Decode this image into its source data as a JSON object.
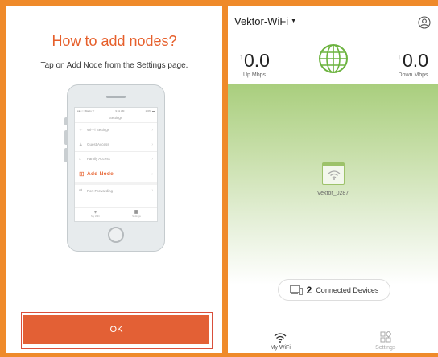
{
  "help": {
    "title": "How to add nodes?",
    "instruction": "Tap on Add Node from the Settings page.",
    "ok_label": "OK",
    "phone_screen": {
      "status_left": "●●●○○ Maxis ᯤ",
      "status_time": "9:41 AM",
      "status_right": "100% ▬",
      "title": "Settings",
      "menu": [
        {
          "icon": "wifi-icon",
          "glyph": "ᯤ",
          "label": "Wi-Fi Settings"
        },
        {
          "icon": "guest-icon",
          "glyph": "♟",
          "label": "Guest Access"
        },
        {
          "icon": "family-icon",
          "glyph": "⌂",
          "label": "Family Access"
        },
        {
          "icon": "add-node-icon",
          "glyph": "⊞",
          "label": "Add Node"
        },
        {
          "icon": "port-forwarding-icon",
          "glyph": "⇄",
          "label": "Port Forwarding"
        }
      ],
      "tabs": [
        {
          "glyph": "ᯤ",
          "label": "My WiFi"
        },
        {
          "glyph": "▦",
          "label": "Settings"
        }
      ]
    }
  },
  "app": {
    "network_name": "Vektor-WiFi",
    "up": {
      "value": "0.0",
      "unit": "Up Mbps"
    },
    "down": {
      "value": "0.0",
      "unit": "Down Mbps"
    },
    "node_name": "Vektor_0287",
    "connected_count": "2",
    "connected_label": "Connected Devices",
    "tabs": [
      {
        "label": "My WiFi",
        "icon": "wifi-icon"
      },
      {
        "label": "Settings",
        "icon": "settings-grid-icon"
      }
    ],
    "colors": {
      "accent": "#e36035",
      "frame": "#ef8a2a",
      "green": "#a9ce7d"
    }
  }
}
